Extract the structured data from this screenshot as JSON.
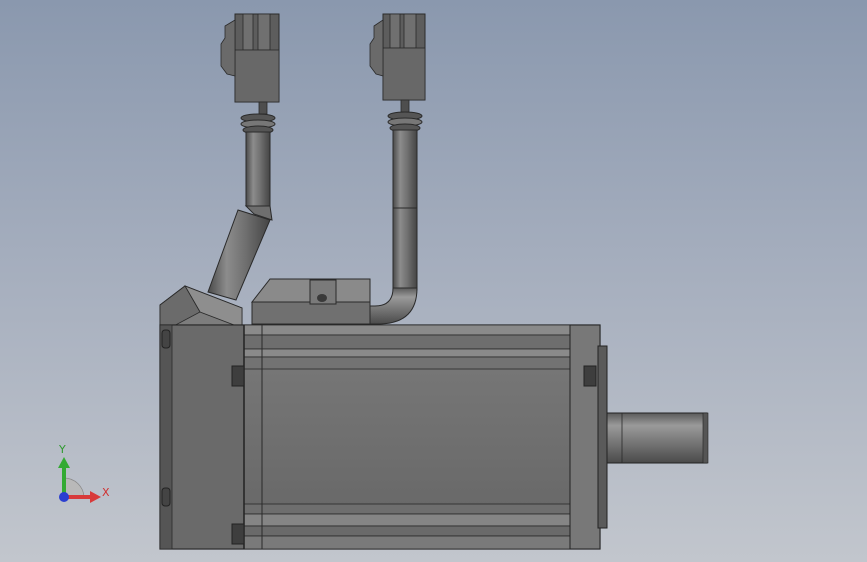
{
  "triad": {
    "x_label": "X",
    "y_label": "Y",
    "x_color": "#d83a3a",
    "y_color": "#33aa33",
    "z_color": "#2a3ed0"
  },
  "colors": {
    "background_top": "#8a98ae",
    "background_bottom": "#c2c6cd",
    "body": "#6d6d6d",
    "body_dark": "#4a4a4a",
    "body_light": "#9a9a9a"
  }
}
